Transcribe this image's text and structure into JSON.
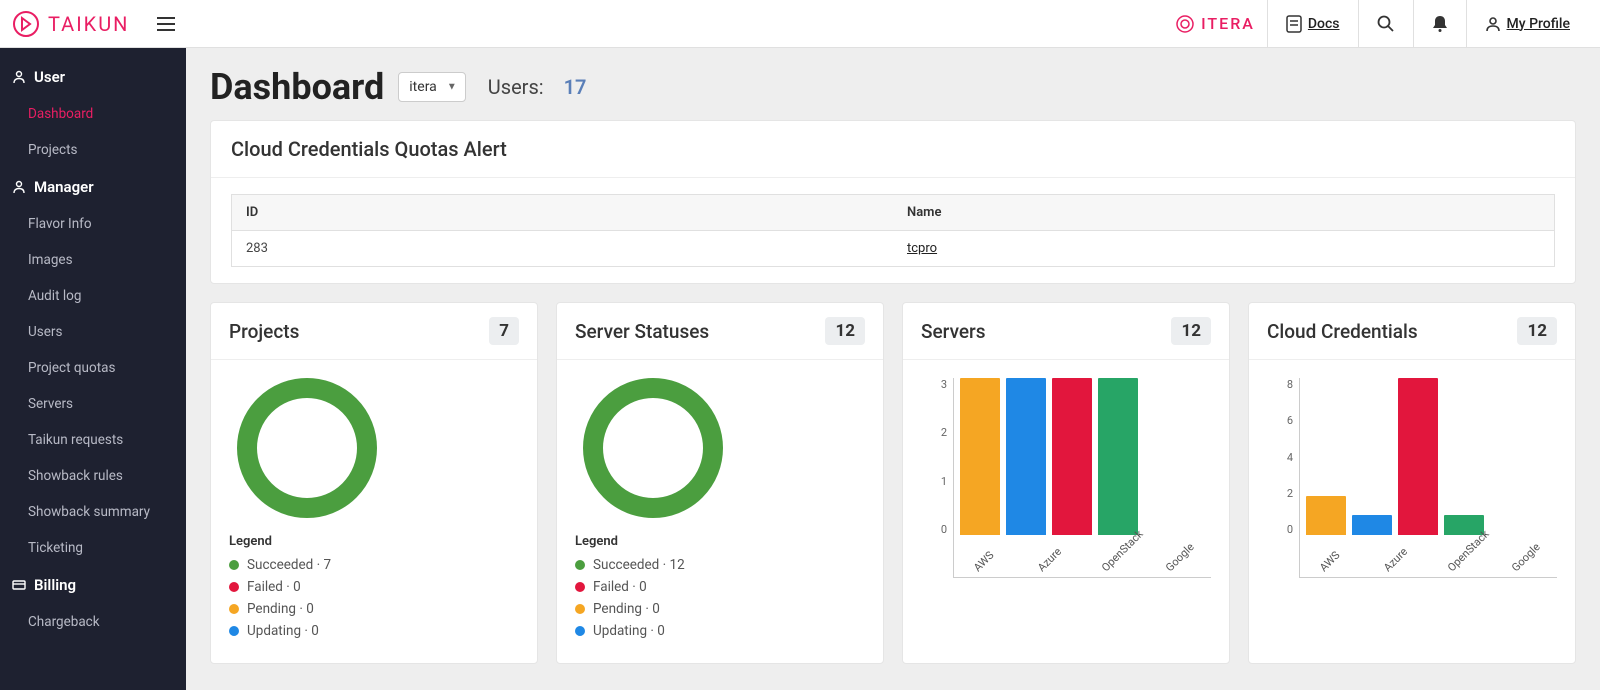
{
  "colors": {
    "accent": "#e91e63",
    "green": "#4b9e3f",
    "red": "#e2163d",
    "orange": "#f5a623",
    "blue": "#1f88e5"
  },
  "topbar": {
    "logo": "TAIKUN",
    "brand2": "ITERA",
    "docs": "Docs",
    "profile": "My Profile"
  },
  "sidebar": {
    "user": {
      "title": "User",
      "items": [
        {
          "label": "Dashboard",
          "active": true
        },
        {
          "label": "Projects"
        }
      ]
    },
    "manager": {
      "title": "Manager",
      "items": [
        {
          "label": "Flavor Info"
        },
        {
          "label": "Images"
        },
        {
          "label": "Audit log"
        },
        {
          "label": "Users"
        },
        {
          "label": "Project quotas"
        },
        {
          "label": "Servers"
        },
        {
          "label": "Taikun requests"
        },
        {
          "label": "Showback rules"
        },
        {
          "label": "Showback summary"
        },
        {
          "label": "Ticketing"
        }
      ]
    },
    "billing": {
      "title": "Billing",
      "items": [
        {
          "label": "Chargeback"
        }
      ]
    }
  },
  "page": {
    "title": "Dashboard",
    "org_selected": "itera",
    "users_label": "Users:",
    "users_count": "17"
  },
  "alert_card": {
    "title": "Cloud Credentials Quotas Alert",
    "cols": {
      "id": "ID",
      "name": "Name"
    },
    "rows": [
      {
        "id": "283",
        "name": "tcpro"
      }
    ]
  },
  "projects_card": {
    "title": "Projects",
    "count": "7",
    "legend_title": "Legend",
    "legend": [
      {
        "color": "#4b9e3f",
        "label": "Succeeded · 7"
      },
      {
        "color": "#e2163d",
        "label": "Failed · 0"
      },
      {
        "color": "#f5a623",
        "label": "Pending · 0"
      },
      {
        "color": "#1f88e5",
        "label": "Updating · 0"
      }
    ]
  },
  "statuses_card": {
    "title": "Server Statuses",
    "count": "12",
    "legend_title": "Legend",
    "legend": [
      {
        "color": "#4b9e3f",
        "label": "Succeeded · 12"
      },
      {
        "color": "#e2163d",
        "label": "Failed · 0"
      },
      {
        "color": "#f5a623",
        "label": "Pending · 0"
      },
      {
        "color": "#1f88e5",
        "label": "Updating · 0"
      }
    ]
  },
  "servers_card": {
    "title": "Servers",
    "count": "12"
  },
  "creds_card": {
    "title": "Cloud Credentials",
    "count": "12"
  },
  "chart_data": [
    {
      "id": "servers",
      "type": "bar",
      "title": "Servers",
      "ylabel": "",
      "y_ticks": [
        0.0,
        1.0,
        2.0,
        3.0
      ],
      "ylim": [
        0,
        3
      ],
      "categories": [
        "AWS",
        "Azure",
        "OpenStack",
        "Google"
      ],
      "values": [
        3,
        3,
        3,
        3
      ],
      "colors": [
        "#f5a623",
        "#1f88e5",
        "#e2163d",
        "#27a566"
      ]
    },
    {
      "id": "cloud_credentials",
      "type": "bar",
      "title": "Cloud Credentials",
      "ylabel": "",
      "y_ticks": [
        0,
        2,
        4,
        6,
        8
      ],
      "ylim": [
        0,
        8
      ],
      "categories": [
        "AWS",
        "Azure",
        "OpenStack",
        "Google"
      ],
      "values": [
        2,
        1,
        8,
        1
      ],
      "colors": [
        "#f5a623",
        "#1f88e5",
        "#e2163d",
        "#27a566"
      ]
    },
    {
      "id": "projects_donut",
      "type": "pie",
      "title": "Projects",
      "series": [
        {
          "name": "Succeeded",
          "value": 7,
          "color": "#4b9e3f"
        },
        {
          "name": "Failed",
          "value": 0,
          "color": "#e2163d"
        },
        {
          "name": "Pending",
          "value": 0,
          "color": "#f5a623"
        },
        {
          "name": "Updating",
          "value": 0,
          "color": "#1f88e5"
        }
      ]
    },
    {
      "id": "server_statuses_donut",
      "type": "pie",
      "title": "Server Statuses",
      "series": [
        {
          "name": "Succeeded",
          "value": 12,
          "color": "#4b9e3f"
        },
        {
          "name": "Failed",
          "value": 0,
          "color": "#e2163d"
        },
        {
          "name": "Pending",
          "value": 0,
          "color": "#f5a623"
        },
        {
          "name": "Updating",
          "value": 0,
          "color": "#1f88e5"
        }
      ]
    }
  ]
}
